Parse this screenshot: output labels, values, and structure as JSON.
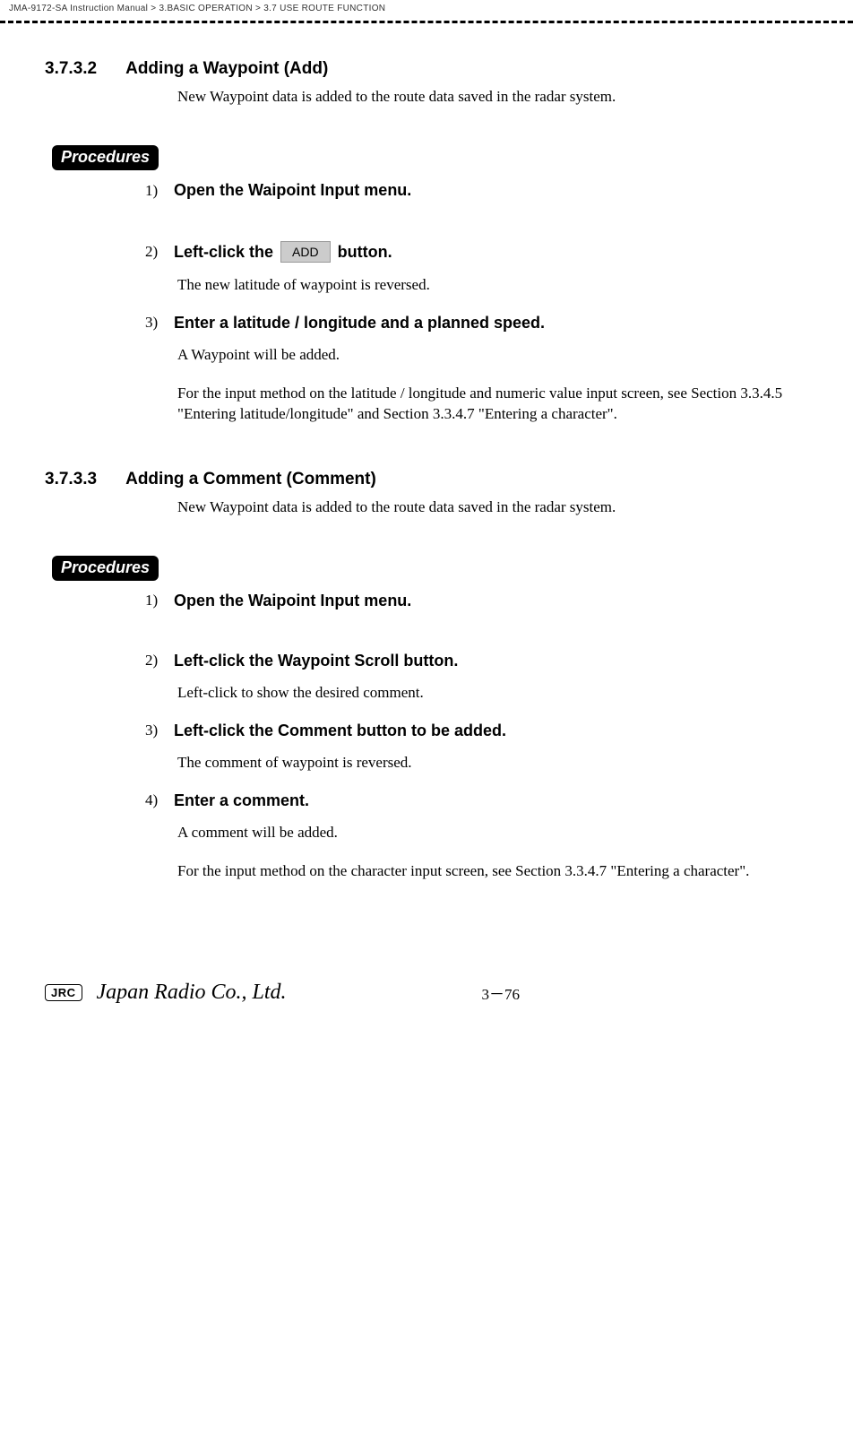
{
  "breadcrumb": {
    "manual": "JMA-9172-SA Instruction Manual",
    "sep1": ">",
    "chapter": "3.BASIC OPERATION",
    "sep2": ">",
    "section": "3.7  USE ROUTE FUNCTION"
  },
  "section1": {
    "number": "3.7.3.2",
    "title": "Adding a Waypoint (Add)",
    "intro": "New Waypoint data is added to the route data saved in the radar system.",
    "procedures_label": "Procedures",
    "steps": {
      "s1": {
        "num": "1)",
        "text": "Open the Waipoint Input menu."
      },
      "s2": {
        "num": "2)",
        "pre": "Left-click the ",
        "btn": "ADD",
        "post": " button.",
        "body": "The new latitude of waypoint is reversed."
      },
      "s3": {
        "num": "3)",
        "text": "Enter a latitude / longitude and a planned speed.",
        "body1": "A Waypoint will be added.",
        "body2": "For the input method on the latitude / longitude and numeric value input screen, see Section 3.3.4.5 \"Entering latitude/longitude\" and Section 3.3.4.7 \"Entering a character\"."
      }
    }
  },
  "section2": {
    "number": "3.7.3.3",
    "title": "Adding a Comment (Comment)",
    "intro": "New Waypoint data is added to the route data saved in the radar system.",
    "procedures_label": "Procedures",
    "steps": {
      "s1": {
        "num": "1)",
        "text": "Open the Waipoint Input menu."
      },
      "s2": {
        "num": "2)",
        "text": "Left-click the  Waypoint Scroll  button.",
        "body": "Left-click to show the desired comment."
      },
      "s3": {
        "num": "3)",
        "text": "Left-click the  Comment  button to be added.",
        "body": "The comment of waypoint is reversed."
      },
      "s4": {
        "num": "4)",
        "text": "Enter a comment.",
        "body1": "A comment will be added.",
        "body2": "For the input method on the character input screen, see Section 3.3.4.7 \"Entering a character\"."
      }
    }
  },
  "footer": {
    "jrc": "JRC",
    "company": "Japan Radio Co., Ltd.",
    "page": "3－76"
  }
}
